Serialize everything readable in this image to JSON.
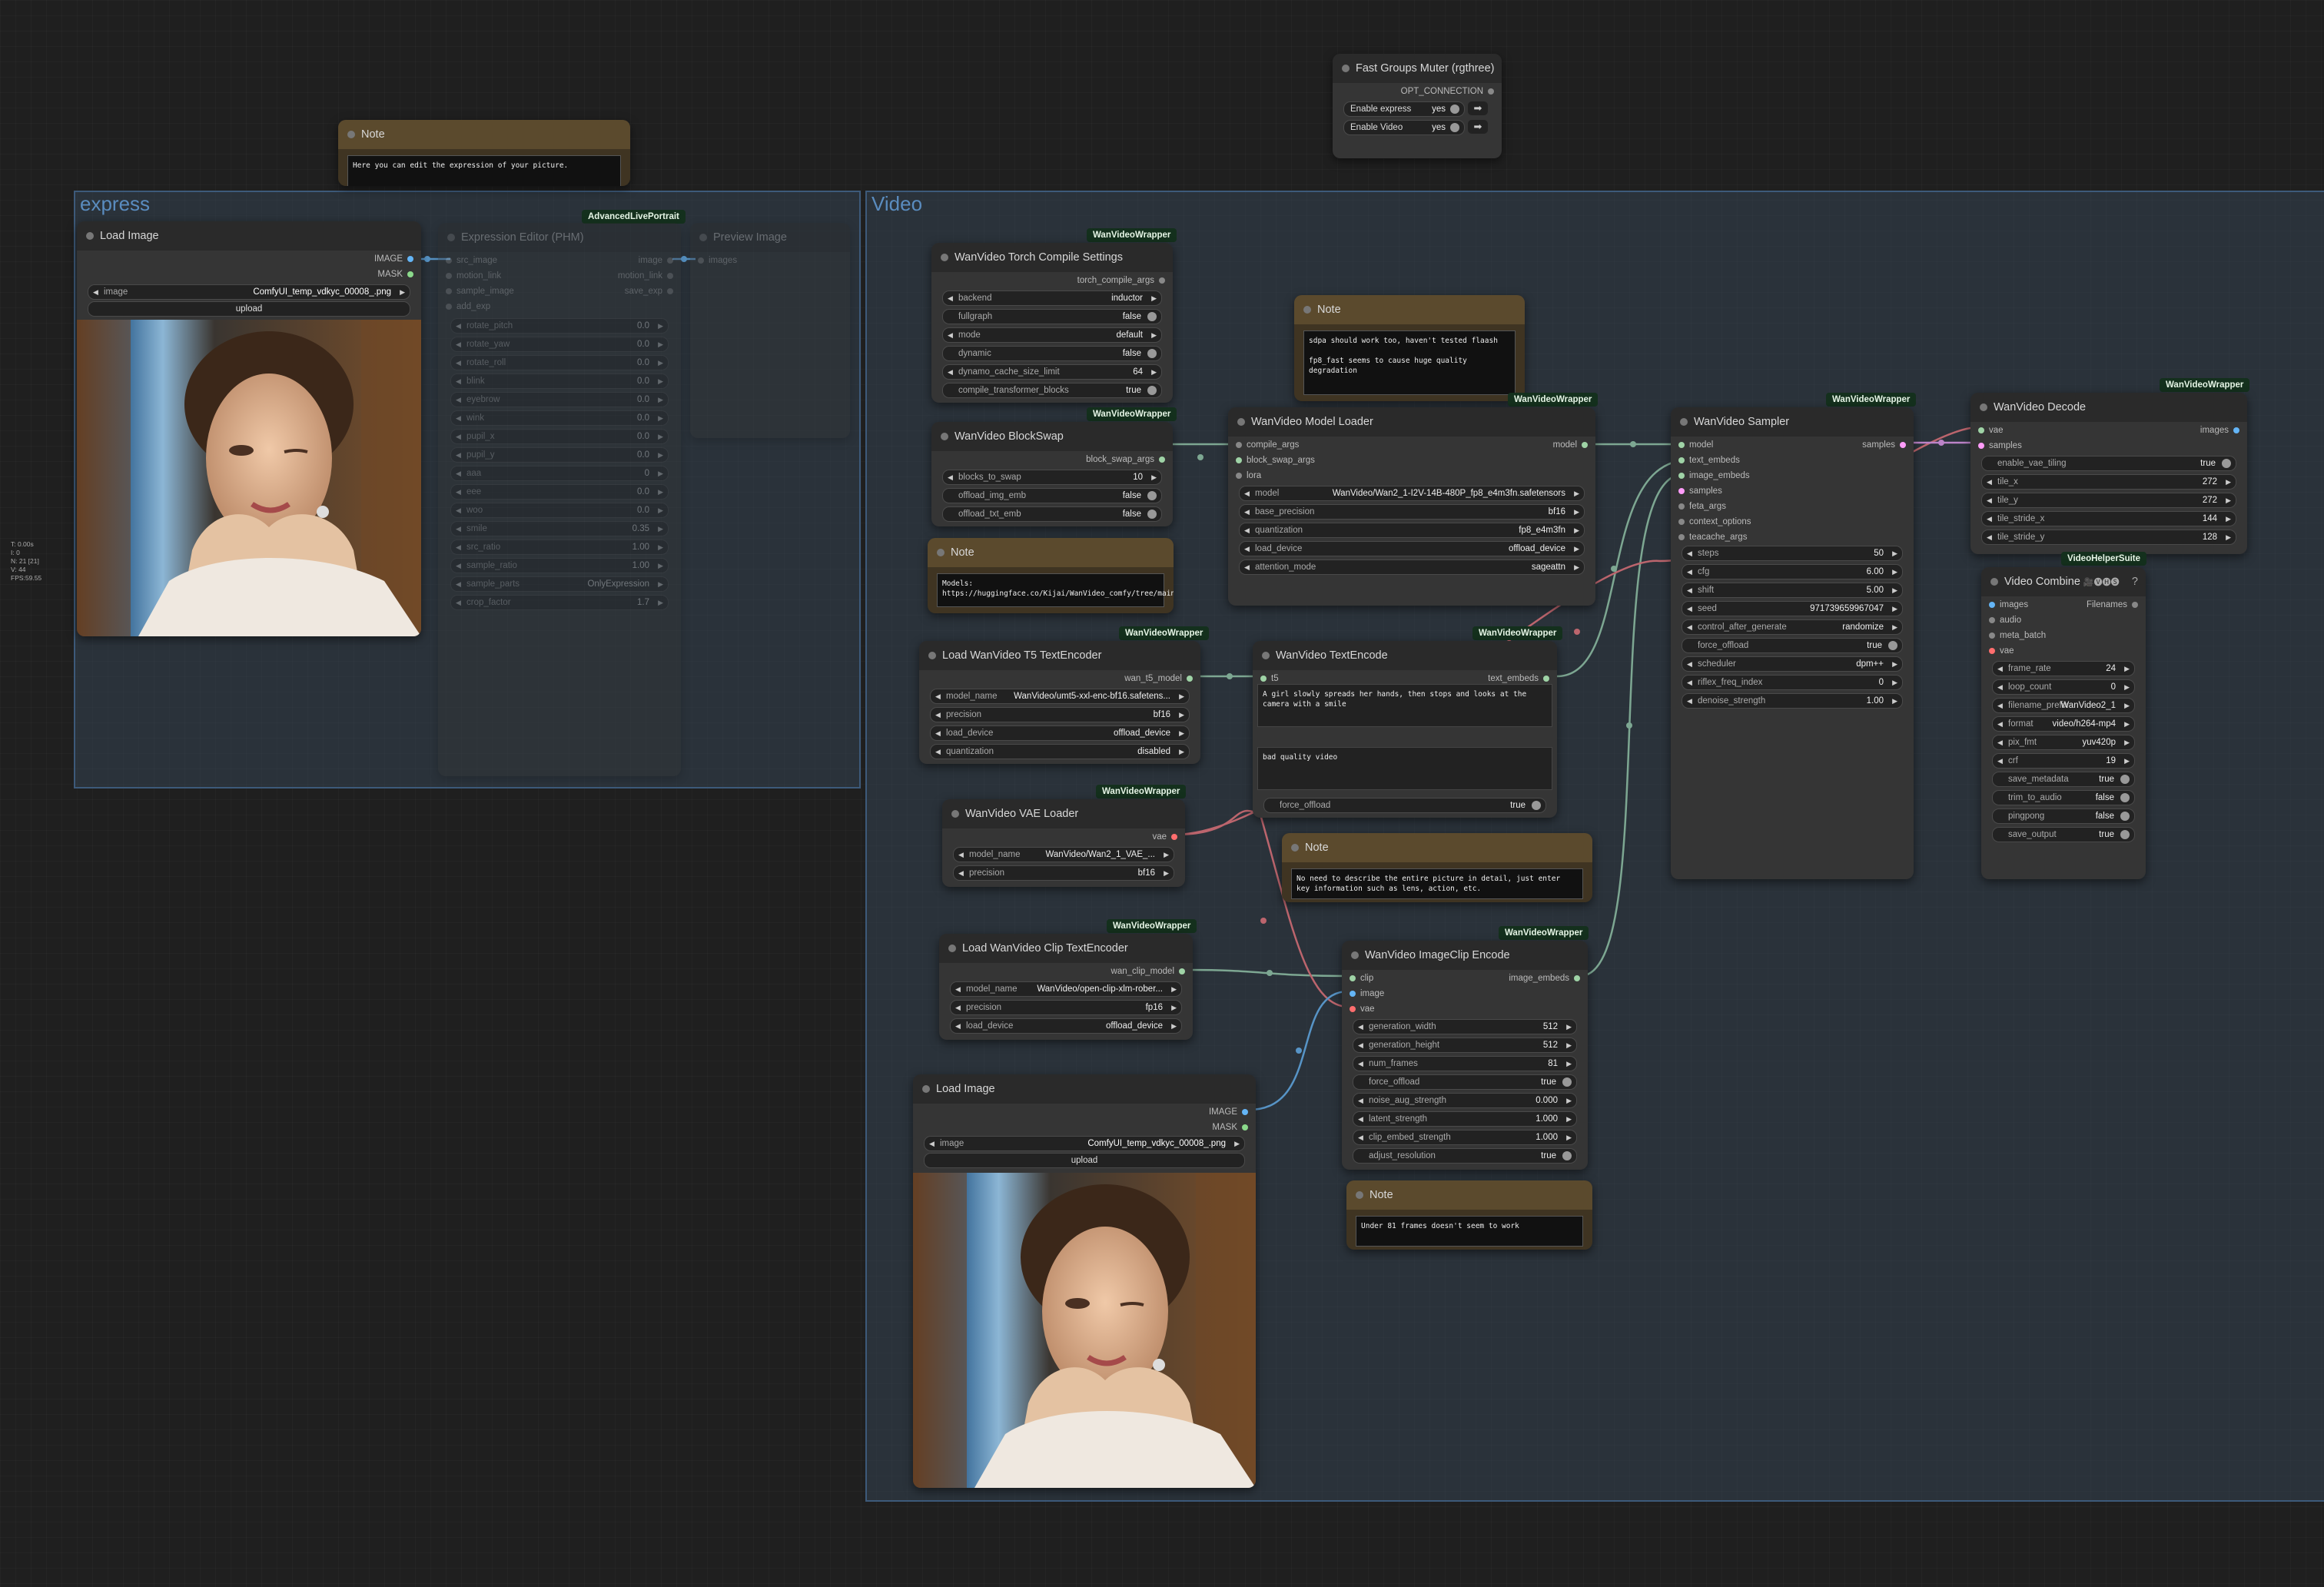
{
  "stats": [
    "T: 0.00s",
    "I: 0",
    "N: 21 [21]",
    "V: 44",
    "FPS:59.55"
  ],
  "groups": {
    "express": "express",
    "video": "Video"
  },
  "badges": {
    "wvw": "WanVideoWrapper",
    "alp": "AdvancedLivePortrait",
    "vhs": "VideoHelperSuite"
  },
  "fast_groups": {
    "title": "Fast Groups Muter (rgthree)",
    "opt": "OPT_CONNECTION",
    "rows": [
      {
        "label": "Enable express",
        "value": "yes"
      },
      {
        "label": "Enable Video",
        "value": "yes"
      }
    ]
  },
  "note_top": {
    "title": "Note",
    "text": "Here you can edit the expression of your picture."
  },
  "load_image_1": {
    "title": "Load Image",
    "out1": "IMAGE",
    "out2": "MASK",
    "image_label": "image",
    "image_value": "ComfyUI_temp_vdkyc_00008_.png",
    "upload": "upload"
  },
  "expression_editor": {
    "title": "Expression Editor (PHM)",
    "inputs": [
      "src_image",
      "motion_link",
      "sample_image",
      "add_exp"
    ],
    "outputs": [
      "image",
      "motion_link",
      "save_exp"
    ],
    "widgets": [
      {
        "l": "rotate_pitch",
        "v": "0.0"
      },
      {
        "l": "rotate_yaw",
        "v": "0.0"
      },
      {
        "l": "rotate_roll",
        "v": "0.0"
      },
      {
        "l": "blink",
        "v": "0.0"
      },
      {
        "l": "eyebrow",
        "v": "0.0"
      },
      {
        "l": "wink",
        "v": "0.0"
      },
      {
        "l": "pupil_x",
        "v": "0.0"
      },
      {
        "l": "pupil_y",
        "v": "0.0"
      },
      {
        "l": "aaa",
        "v": "0"
      },
      {
        "l": "eee",
        "v": "0.0"
      },
      {
        "l": "woo",
        "v": "0.0"
      },
      {
        "l": "smile",
        "v": "0.35"
      },
      {
        "l": "src_ratio",
        "v": "1.00"
      },
      {
        "l": "sample_ratio",
        "v": "1.00"
      },
      {
        "l": "sample_parts",
        "v": "OnlyExpression"
      },
      {
        "l": "crop_factor",
        "v": "1.7"
      }
    ]
  },
  "preview_image": {
    "title": "Preview Image",
    "input": "images"
  },
  "torch_compile": {
    "title": "WanVideo Torch Compile Settings",
    "out": "torch_compile_args",
    "widgets": [
      {
        "l": "backend",
        "v": "inductor",
        "t": "c"
      },
      {
        "l": "fullgraph",
        "v": "false",
        "t": "t"
      },
      {
        "l": "mode",
        "v": "default",
        "t": "c"
      },
      {
        "l": "dynamic",
        "v": "false",
        "t": "t"
      },
      {
        "l": "dynamo_cache_size_limit",
        "v": "64",
        "t": "c"
      },
      {
        "l": "compile_transformer_blocks",
        "v": "true",
        "t": "t"
      }
    ]
  },
  "blockswap": {
    "title": "WanVideo BlockSwap",
    "out": "block_swap_args",
    "widgets": [
      {
        "l": "blocks_to_swap",
        "v": "10",
        "t": "c"
      },
      {
        "l": "offload_img_emb",
        "v": "false",
        "t": "t"
      },
      {
        "l": "offload_txt_emb",
        "v": "false",
        "t": "t"
      }
    ]
  },
  "note_models": {
    "title": "Note",
    "text": "Models:\nhttps://huggingface.co/Kijai/WanVideo_comfy/tree/main"
  },
  "note_sdpa": {
    "title": "Note",
    "text": "sdpa should work too, haven't tested flaash\n\nfp8_fast seems to cause huge quality degradation"
  },
  "model_loader": {
    "title": "WanVideo Model Loader",
    "inputs": [
      "compile_args",
      "block_swap_args",
      "lora"
    ],
    "out": "model",
    "widgets": [
      {
        "l": "model",
        "v": "WanVideo/Wan2_1-I2V-14B-480P_fp8_e4m3fn.safetensors",
        "t": "c"
      },
      {
        "l": "base_precision",
        "v": "bf16",
        "t": "c"
      },
      {
        "l": "quantization",
        "v": "fp8_e4m3fn",
        "t": "c"
      },
      {
        "l": "load_device",
        "v": "offload_device",
        "t": "c"
      },
      {
        "l": "attention_mode",
        "v": "sageattn",
        "t": "c"
      }
    ]
  },
  "sampler": {
    "title": "WanVideo Sampler",
    "inputs": [
      "model",
      "text_embeds",
      "image_embeds",
      "samples",
      "feta_args",
      "context_options",
      "teacache_args"
    ],
    "out": "samples",
    "widgets": [
      {
        "l": "steps",
        "v": "50",
        "t": "c"
      },
      {
        "l": "cfg",
        "v": "6.00",
        "t": "c"
      },
      {
        "l": "shift",
        "v": "5.00",
        "t": "c"
      },
      {
        "l": "seed",
        "v": "971739659967047",
        "t": "c"
      },
      {
        "l": "control_after_generate",
        "v": "randomize",
        "t": "c"
      },
      {
        "l": "force_offload",
        "v": "true",
        "t": "t"
      },
      {
        "l": "scheduler",
        "v": "dpm++",
        "t": "c"
      },
      {
        "l": "riflex_freq_index",
        "v": "0",
        "t": "c"
      },
      {
        "l": "denoise_strength",
        "v": "1.00",
        "t": "c"
      }
    ]
  },
  "decode": {
    "title": "WanVideo Decode",
    "inputs": [
      "vae",
      "samples"
    ],
    "out": "images",
    "widgets": [
      {
        "l": "enable_vae_tiling",
        "v": "true",
        "t": "t"
      },
      {
        "l": "tile_x",
        "v": "272",
        "t": "c"
      },
      {
        "l": "tile_y",
        "v": "272",
        "t": "c"
      },
      {
        "l": "tile_stride_x",
        "v": "144",
        "t": "c"
      },
      {
        "l": "tile_stride_y",
        "v": "128",
        "t": "c"
      }
    ]
  },
  "video_combine": {
    "title": "Video Combine",
    "title_icons": "🎥🅥🅗🅢",
    "help": "?",
    "inputs": [
      "images",
      "audio",
      "meta_batch",
      "vae"
    ],
    "out": "Filenames",
    "widgets": [
      {
        "l": "frame_rate",
        "v": "24",
        "t": "c"
      },
      {
        "l": "loop_count",
        "v": "0",
        "t": "c"
      },
      {
        "l": "filename_prefix",
        "v": "WanVideo2_1",
        "t": "s"
      },
      {
        "l": "format",
        "v": "video/h264-mp4",
        "t": "c"
      },
      {
        "l": "pix_fmt",
        "v": "yuv420p",
        "t": "c"
      },
      {
        "l": "crf",
        "v": "19",
        "t": "c"
      },
      {
        "l": "save_metadata",
        "v": "true",
        "t": "t"
      },
      {
        "l": "trim_to_audio",
        "v": "false",
        "t": "t"
      },
      {
        "l": "pingpong",
        "v": "false",
        "t": "t"
      },
      {
        "l": "save_output",
        "v": "true",
        "t": "t"
      }
    ]
  },
  "t5_encoder": {
    "title": "Load WanVideo T5 TextEncoder",
    "out": "wan_t5_model",
    "widgets": [
      {
        "l": "model_name",
        "v": "WanVideo/umt5-xxl-enc-bf16.safetens...",
        "t": "c"
      },
      {
        "l": "precision",
        "v": "bf16",
        "t": "c"
      },
      {
        "l": "load_device",
        "v": "offload_device",
        "t": "c"
      },
      {
        "l": "quantization",
        "v": "disabled",
        "t": "c"
      }
    ]
  },
  "text_encode": {
    "title": "WanVideo TextEncode",
    "input": "t5",
    "out": "text_embeds",
    "positive": "A girl slowly spreads her hands, then stops and looks at the camera with a smile",
    "negative": "bad quality video",
    "force_offload": {
      "l": "force_offload",
      "v": "true"
    }
  },
  "vae_loader": {
    "title": "WanVideo VAE Loader",
    "out": "vae",
    "widgets": [
      {
        "l": "model_name",
        "v": "WanVideo/Wan2_1_VAE_...",
        "t": "c"
      },
      {
        "l": "precision",
        "v": "bf16",
        "t": "c"
      }
    ]
  },
  "note_describe": {
    "title": "Note",
    "text": "No need to describe the entire picture in detail, just enter key information such as lens, action, etc."
  },
  "clip_encoder": {
    "title": "Load WanVideo Clip TextEncoder",
    "out": "wan_clip_model",
    "widgets": [
      {
        "l": "model_name",
        "v": "WanVideo/open-clip-xlm-rober...",
        "t": "c"
      },
      {
        "l": "precision",
        "v": "fp16",
        "t": "c"
      },
      {
        "l": "load_device",
        "v": "offload_device",
        "t": "c"
      }
    ]
  },
  "imageclip": {
    "title": "WanVideo ImageClip Encode",
    "inputs": [
      "clip",
      "image",
      "vae"
    ],
    "out": "image_embeds",
    "widgets": [
      {
        "l": "generation_width",
        "v": "512",
        "t": "c"
      },
      {
        "l": "generation_height",
        "v": "512",
        "t": "c"
      },
      {
        "l": "num_frames",
        "v": "81",
        "t": "c"
      },
      {
        "l": "force_offload",
        "v": "true",
        "t": "t"
      },
      {
        "l": "noise_aug_strength",
        "v": "0.000",
        "t": "c"
      },
      {
        "l": "latent_strength",
        "v": "1.000",
        "t": "c"
      },
      {
        "l": "clip_embed_strength",
        "v": "1.000",
        "t": "c"
      },
      {
        "l": "adjust_resolution",
        "v": "true",
        "t": "t"
      }
    ]
  },
  "load_image_2": {
    "title": "Load Image",
    "out1": "IMAGE",
    "out2": "MASK",
    "image_label": "image",
    "image_value": "ComfyUI_temp_vdkyc_00008_.png",
    "upload": "upload"
  },
  "note_frames": {
    "title": "Note",
    "text": "Under 81 frames doesn't seem to work"
  },
  "colors": {
    "model": "#9fd3a6",
    "image": "#64b5f6",
    "vae": "#ff6e6e",
    "latent": "#ff9cf9",
    "conditioning": "#ffa931"
  }
}
